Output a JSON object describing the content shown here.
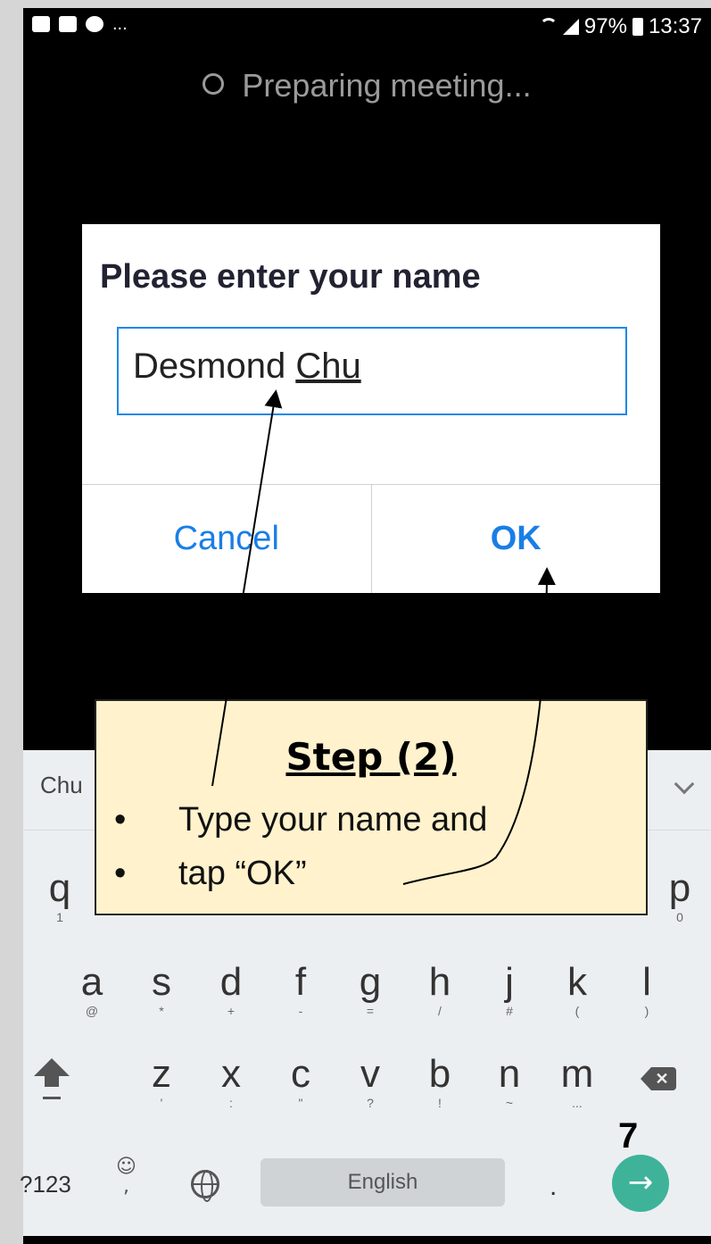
{
  "status_bar": {
    "battery": "97%",
    "time": "13:37",
    "more": "..."
  },
  "preparing": "Preparing meeting...",
  "dialog": {
    "title": "Please enter your name",
    "name_first": "Desmond ",
    "name_last": "Chu",
    "cancel": "Cancel",
    "ok": "OK"
  },
  "keyboard": {
    "suggestion": "Chu",
    "row1": [
      {
        "k": "q",
        "s": "1"
      },
      {
        "k": "p",
        "s": "0"
      }
    ],
    "row2": [
      {
        "k": "a",
        "s": "@"
      },
      {
        "k": "s",
        "s": "*"
      },
      {
        "k": "d",
        "s": "+"
      },
      {
        "k": "f",
        "s": "-"
      },
      {
        "k": "g",
        "s": "="
      },
      {
        "k": "h",
        "s": "/"
      },
      {
        "k": "j",
        "s": "#"
      },
      {
        "k": "k",
        "s": "("
      },
      {
        "k": "l",
        "s": ")"
      }
    ],
    "row3": [
      {
        "k": "z",
        "s": "'"
      },
      {
        "k": "x",
        "s": ":"
      },
      {
        "k": "c",
        "s": "\""
      },
      {
        "k": "v",
        "s": "?"
      },
      {
        "k": "b",
        "s": "!"
      },
      {
        "k": "n",
        "s": "~"
      },
      {
        "k": "m",
        "s": "..."
      }
    ],
    "symbols": "?123",
    "emoji_sub": ",",
    "space_label": "English",
    "period": "."
  },
  "callout": {
    "title": "Step (2)",
    "bullet1": "Type your name and",
    "bullet2": "tap “OK”",
    "bullet_char": "•"
  },
  "page_number": "7",
  "colors": {
    "accent": "#1a7ee6",
    "callout_bg": "#fff2cc",
    "enter": "#3eb39a"
  }
}
